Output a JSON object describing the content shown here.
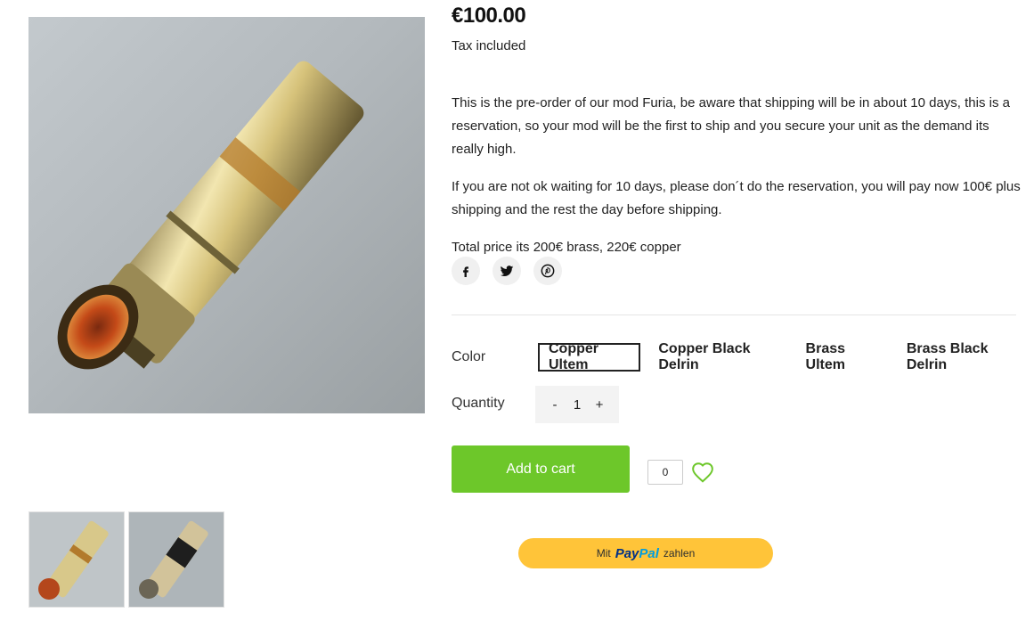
{
  "product": {
    "price": "€100.00",
    "tax_note": "Tax included",
    "description": [
      "This is the pre-order of our mod Furia, be aware that shipping will be in about 10 days, this is a reservation, so your mod will be the first to ship and you secure your unit as the demand its really high.",
      "If you are not ok waiting for 10 days, please don´t do the reservation, you will pay now 100€ plus shipping and the rest the day before shipping.",
      "Total price its 200€ brass, 220€ copper"
    ]
  },
  "share": {
    "icons": [
      "facebook-icon",
      "twitter-icon",
      "pinterest-icon"
    ]
  },
  "options": {
    "color_label": "Color",
    "colors": [
      "Copper Ultem",
      "Copper Black Delrin",
      "Brass Ultem",
      "Brass Black Delrin"
    ],
    "selected_color": "Copper Ultem",
    "quantity_label": "Quantity",
    "quantity_value": "1",
    "decrement_label": "-",
    "increment_label": "+"
  },
  "actions": {
    "add_to_cart": "Add to cart",
    "wishlist_count": "0",
    "paypal_prefix": "Mit",
    "paypal_pay": "Pay",
    "paypal_pal": "Pal",
    "paypal_suffix": "zahlen"
  },
  "colors": {
    "add_to_cart_bg": "#6dc72a",
    "paypal_bg": "#ffc439",
    "paypal_blue_dark": "#003087",
    "paypal_blue_light": "#009cde",
    "heart": "#6dc72a"
  }
}
